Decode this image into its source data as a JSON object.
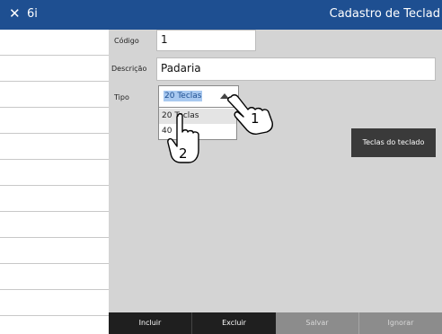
{
  "titlebar": {
    "close_glyph": "✕",
    "app_name": "6i",
    "title": "Cadastro de Teclad"
  },
  "form": {
    "codigo_label": "Código",
    "codigo_value": "1",
    "descricao_label": "Descrição",
    "descricao_value": "Padaria",
    "tipo_label": "Tipo",
    "tipo_selected": "20 Teclas",
    "tipo_options": [
      "20 Teclas",
      "40"
    ]
  },
  "teclas_button_label": "Teclas do teclado",
  "annotations": {
    "cursor1_number": "1",
    "cursor2_number": "2"
  },
  "toolbar": {
    "incluir_label": "Incluir",
    "excluir_label": "Excluir",
    "salvar_label": "Salvar",
    "ignorar_label": "Ignorar"
  },
  "colors": {
    "titlebar": "#1e4f91",
    "active_button": "#1f1f1f",
    "disabled_button": "#8c8c8c",
    "selection": "#a9c9f0"
  }
}
